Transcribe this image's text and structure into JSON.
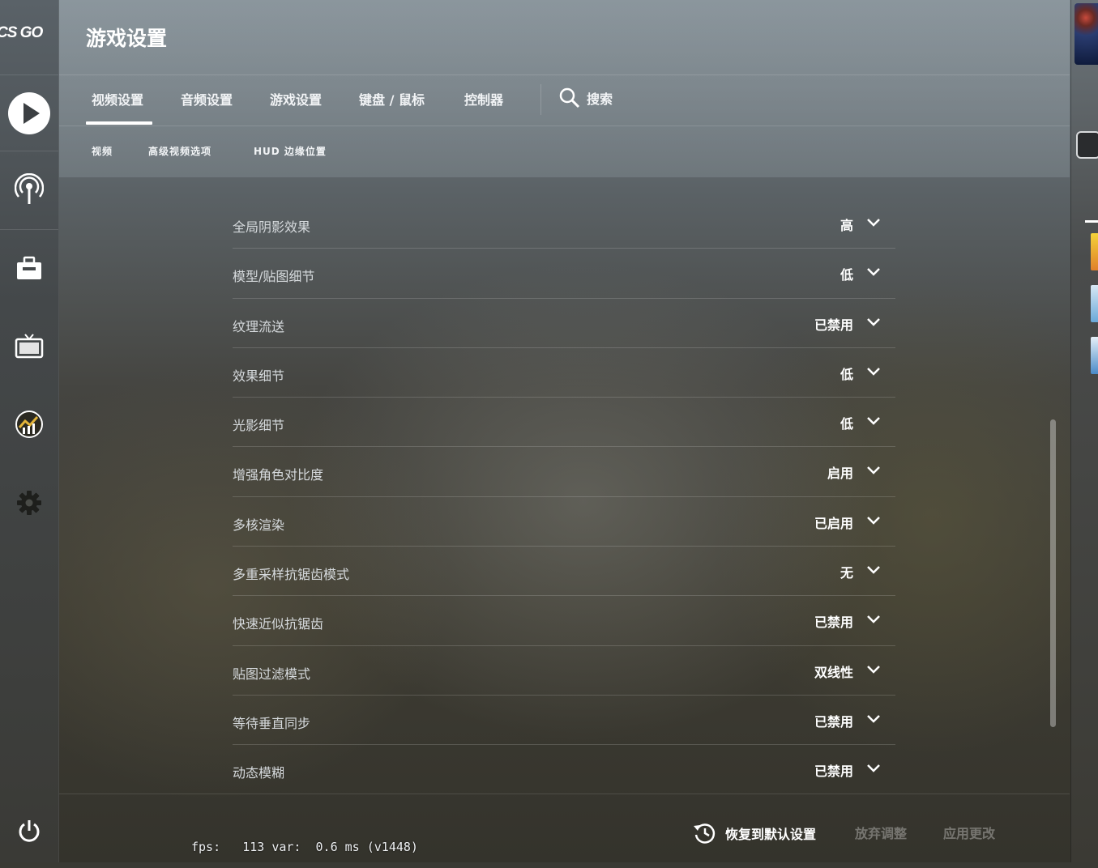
{
  "logo_text": "CS GO",
  "page_title": "游戏设置",
  "tabs": [
    {
      "label": "视频设置",
      "active": true
    },
    {
      "label": "音频设置",
      "active": false
    },
    {
      "label": "游戏设置",
      "active": false
    },
    {
      "label": "键盘 / 鼠标",
      "active": false
    },
    {
      "label": "控制器",
      "active": false
    }
  ],
  "search": {
    "label": "搜索",
    "icon": "search-icon"
  },
  "subtabs": [
    "视频",
    "高级视频选项",
    "HUD 边缘位置"
  ],
  "settings": [
    {
      "label": "全局阴影效果",
      "value": "高"
    },
    {
      "label": "模型/贴图细节",
      "value": "低"
    },
    {
      "label": "纹理流送",
      "value": "已禁用"
    },
    {
      "label": "效果细节",
      "value": "低"
    },
    {
      "label": "光影细节",
      "value": "低"
    },
    {
      "label": "增强角色对比度",
      "value": "启用"
    },
    {
      "label": "多核渲染",
      "value": "已启用"
    },
    {
      "label": "多重采样抗锯齿模式",
      "value": "无"
    },
    {
      "label": "快速近似抗锯齿",
      "value": "已禁用"
    },
    {
      "label": "贴图过滤模式",
      "value": "双线性"
    },
    {
      "label": "等待垂直同步",
      "value": "已禁用"
    },
    {
      "label": "动态模糊",
      "value": "已禁用"
    }
  ],
  "footer": {
    "restore_label": "恢复到默认设置",
    "discard_label": "放弃调整",
    "apply_label": "应用更改"
  },
  "fps_text": "fps:   113 var:  0.6 ms (v1448)",
  "sidebar_icons": [
    "play-icon",
    "broadcast-icon",
    "inventory-icon",
    "tv-icon",
    "stats-icon",
    "gear-icon",
    "power-icon"
  ],
  "colors": {
    "accent": "#ffffff",
    "disabled_text": "#7c7e7e"
  }
}
